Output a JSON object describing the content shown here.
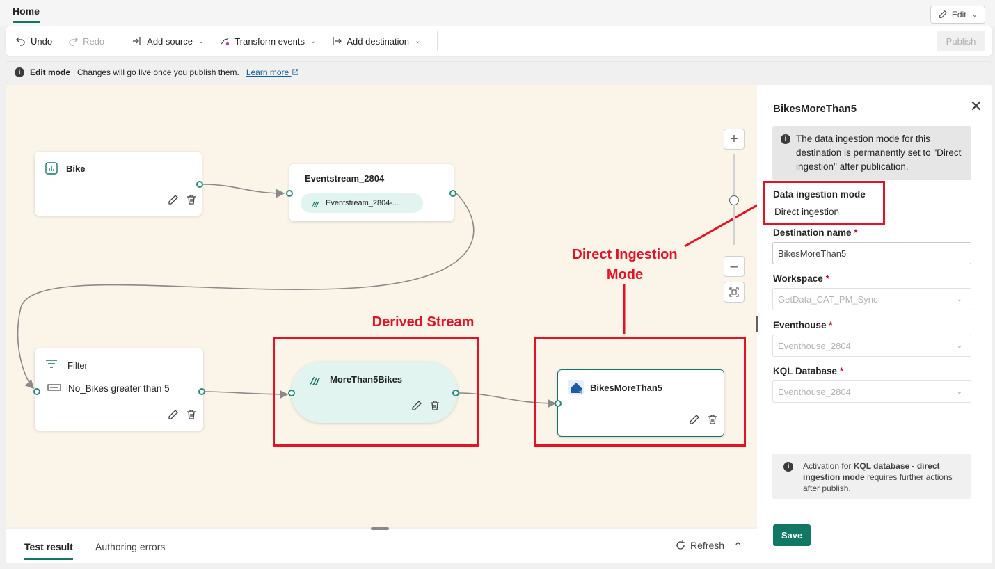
{
  "header": {
    "home_tab": "Home",
    "edit_label": "Edit"
  },
  "toolbar": {
    "undo": "Undo",
    "redo": "Redo",
    "add_source": "Add source",
    "transform_events": "Transform events",
    "add_destination": "Add destination",
    "publish": "Publish"
  },
  "infobar": {
    "title": "Edit mode",
    "message": "Changes will go live once you publish them.",
    "link": "Learn more"
  },
  "canvas": {
    "nodes": {
      "bike": {
        "title": "Bike"
      },
      "eventstream": {
        "title": "Eventstream_2804",
        "pill": "Eventstream_2804-..."
      },
      "filter": {
        "title": "Filter",
        "condition": "No_Bikes greater than 5"
      },
      "derived": {
        "title": "MoreThan5Bikes"
      },
      "destination": {
        "title": "BikesMoreThan5"
      }
    },
    "annotations": {
      "derived_stream": "Derived Stream",
      "direct_ingestion_line1": "Direct Ingestion",
      "direct_ingestion_line2": "Mode"
    }
  },
  "bottom": {
    "tabs": [
      "Test result",
      "Authoring errors"
    ],
    "refresh": "Refresh"
  },
  "panel": {
    "title": "BikesMoreThan5",
    "notice": "The data ingestion mode for this destination is permanently set to \"Direct ingestion\" after publication.",
    "ingestion_mode_label": "Data ingestion mode",
    "ingestion_mode_value": "Direct ingestion",
    "destination_name_label": "Destination name",
    "destination_name_value": "BikesMoreThan5",
    "workspace_label": "Workspace",
    "workspace_value": "GetData_CAT_PM_Sync",
    "eventhouse_label": "Eventhouse",
    "eventhouse_value": "Eventhouse_2804",
    "kql_label": "KQL Database",
    "kql_value": "Eventhouse_2804",
    "activation_prefix": "Activation for ",
    "activation_bold": "KQL database - direct ingestion mode",
    "activation_suffix": " requires further actions after publish.",
    "save": "Save"
  },
  "colors": {
    "accent": "#117865",
    "annotation": "#e81123",
    "canvas_bg": "#fbf4e8",
    "port": "#2b8a7e"
  }
}
